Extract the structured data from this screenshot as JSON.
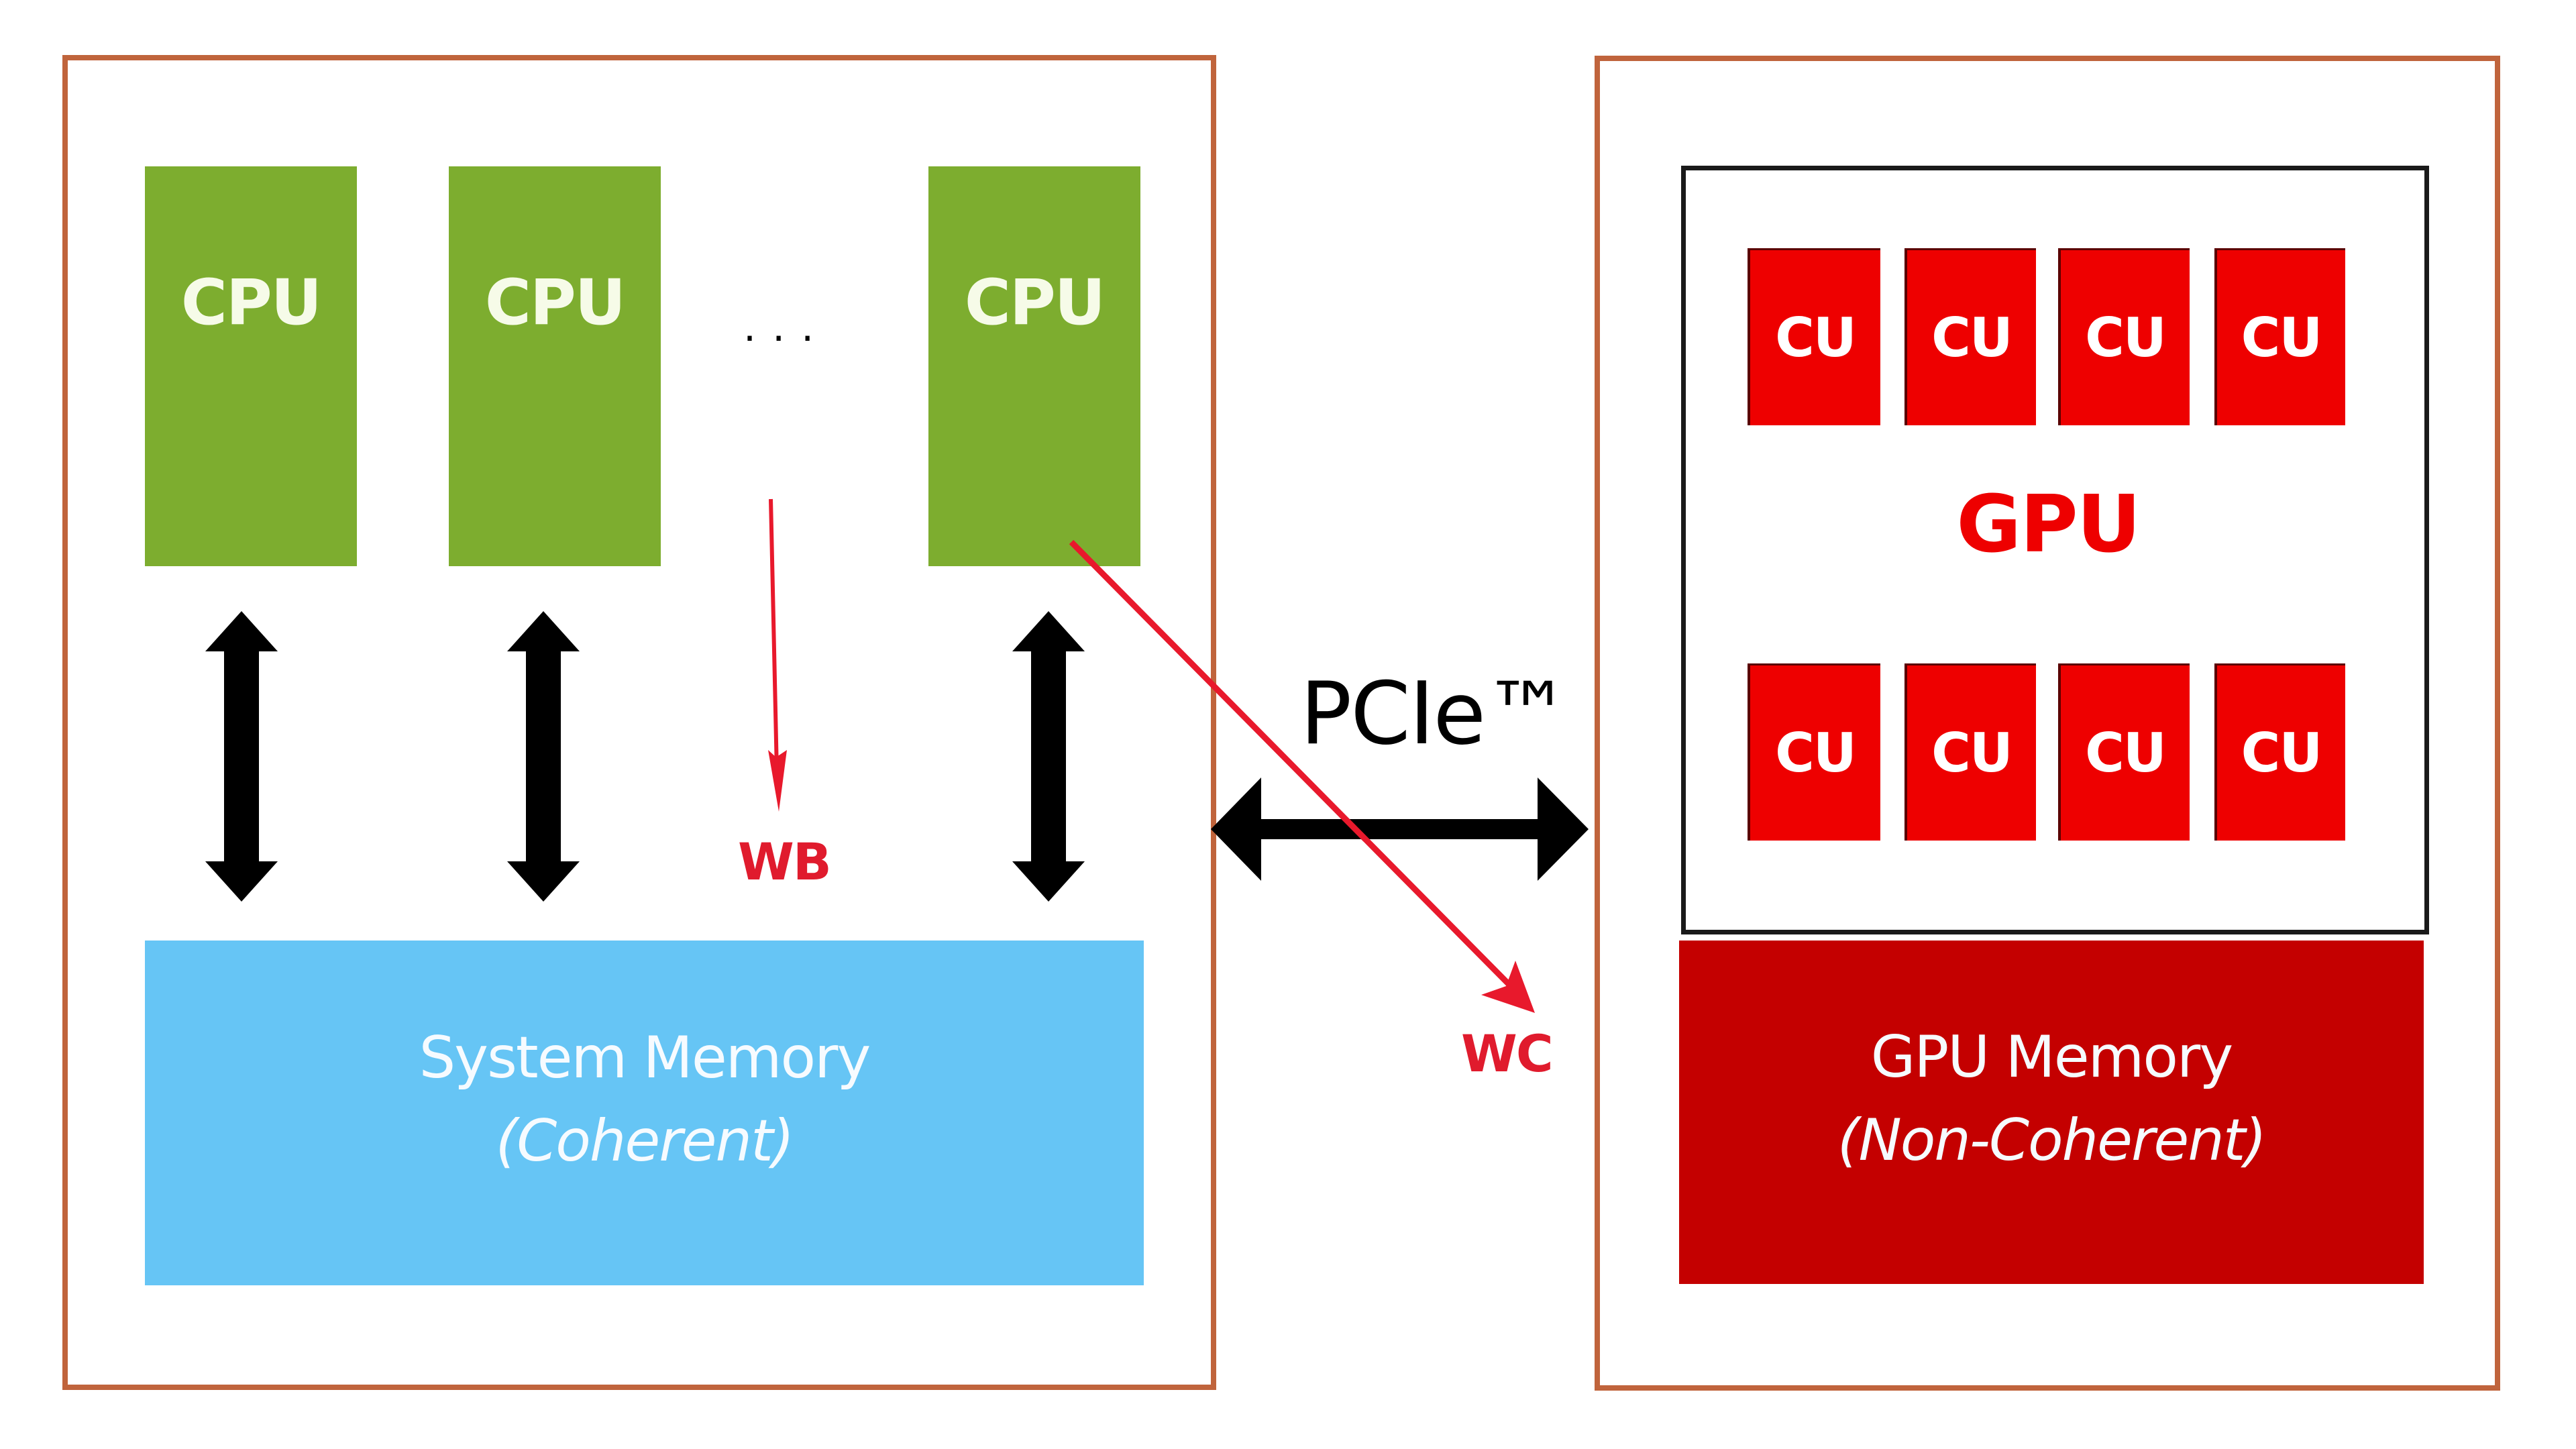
{
  "host": {
    "cpus": [
      {
        "label": "CPU"
      },
      {
        "label": "CPU"
      },
      {
        "label": "CPU"
      }
    ],
    "ellipsis": "···",
    "system_memory": {
      "title": "System Memory",
      "subtitle": "(Coherent)"
    },
    "wb_label": "WB"
  },
  "interconnect": {
    "label": "PCIe™",
    "wc_label": "WC"
  },
  "device": {
    "gpu_label": "GPU",
    "cu_rows": [
      [
        "CU",
        "CU",
        "CU",
        "CU"
      ],
      [
        "CU",
        "CU",
        "CU",
        "CU"
      ]
    ],
    "gpu_memory": {
      "title": "GPU Memory",
      "subtitle": "(Non-Coherent)"
    }
  },
  "colors": {
    "cpu": "#7dad2f",
    "cu": "#ee0000",
    "system_memory": "#66c5f5",
    "gpu_memory": "#c40000",
    "annotation_red": "#e8192c",
    "frame": "#c0643c"
  }
}
